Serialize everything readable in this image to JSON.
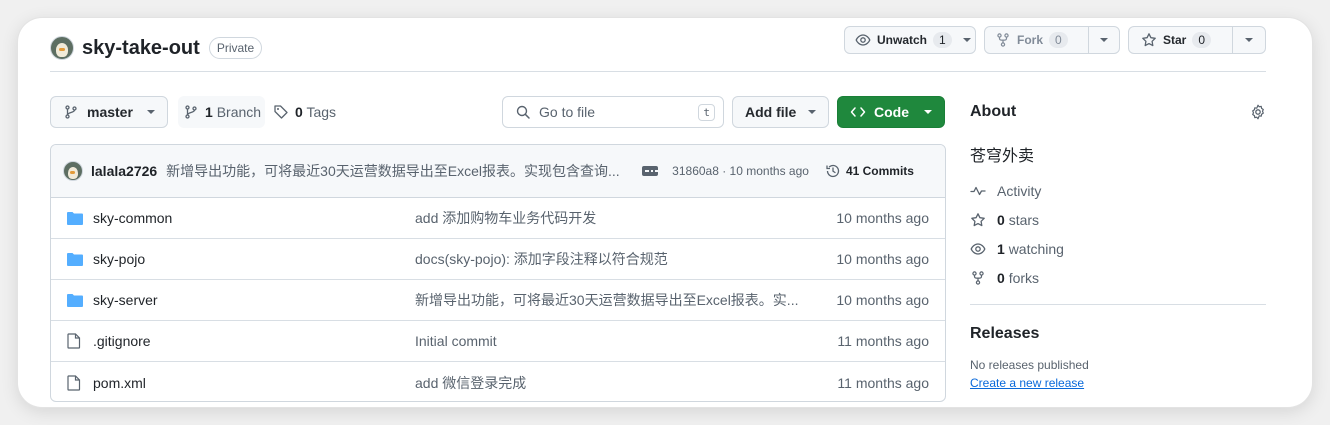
{
  "repo": {
    "name": "sky-take-out",
    "visibility": "Private",
    "unwatch_label": "Unwatch",
    "watch_count": "1",
    "fork_label": "Fork",
    "fork_count": "0",
    "star_label": "Star",
    "star_count": "0"
  },
  "toolbar": {
    "branch": "master",
    "branch_count": "1",
    "branch_label": "Branch",
    "tag_count": "0",
    "tag_label": "Tags",
    "goto_placeholder": "Go to file",
    "goto_shortcut": "t",
    "add_file_label": "Add file",
    "code_label": "Code"
  },
  "commit": {
    "author": "lalala2726",
    "message": "新增导出功能，可将最近30天运营数据导出至Excel报表。实现包含查询...",
    "meta": "31860a8 · 10 months ago",
    "commits_label": "41 Commits"
  },
  "files": [
    {
      "type": "folder",
      "name": "sky-common",
      "message": "add 添加购物车业务代码开发",
      "date": "10 months ago"
    },
    {
      "type": "folder",
      "name": "sky-pojo",
      "message": "docs(sky-pojo): 添加字段注释以符合规范",
      "date": "10 months ago"
    },
    {
      "type": "folder",
      "name": "sky-server",
      "message": "新增导出功能，可将最近30天运营数据导出至Excel报表。实...",
      "date": "10 months ago"
    },
    {
      "type": "file",
      "name": ".gitignore",
      "message": "Initial commit",
      "date": "11 months ago"
    },
    {
      "type": "file",
      "name": "pom.xml",
      "message": "add 微信登录完成",
      "date": "11 months ago"
    }
  ],
  "about": {
    "title": "About",
    "description": "苍穹外卖",
    "activity": "Activity",
    "stars_count": "0",
    "stars_label": "stars",
    "watching_count": "1",
    "watching_label": "watching",
    "forks_count": "0",
    "forks_label": "forks"
  },
  "releases": {
    "title": "Releases",
    "none_text": "No releases published",
    "create_link": "Create a new release"
  },
  "icons": {
    "folder_color": "#54aeff",
    "file_color": "#59636e",
    "code_button_color": "#1f883d",
    "link_color": "#0969da"
  }
}
